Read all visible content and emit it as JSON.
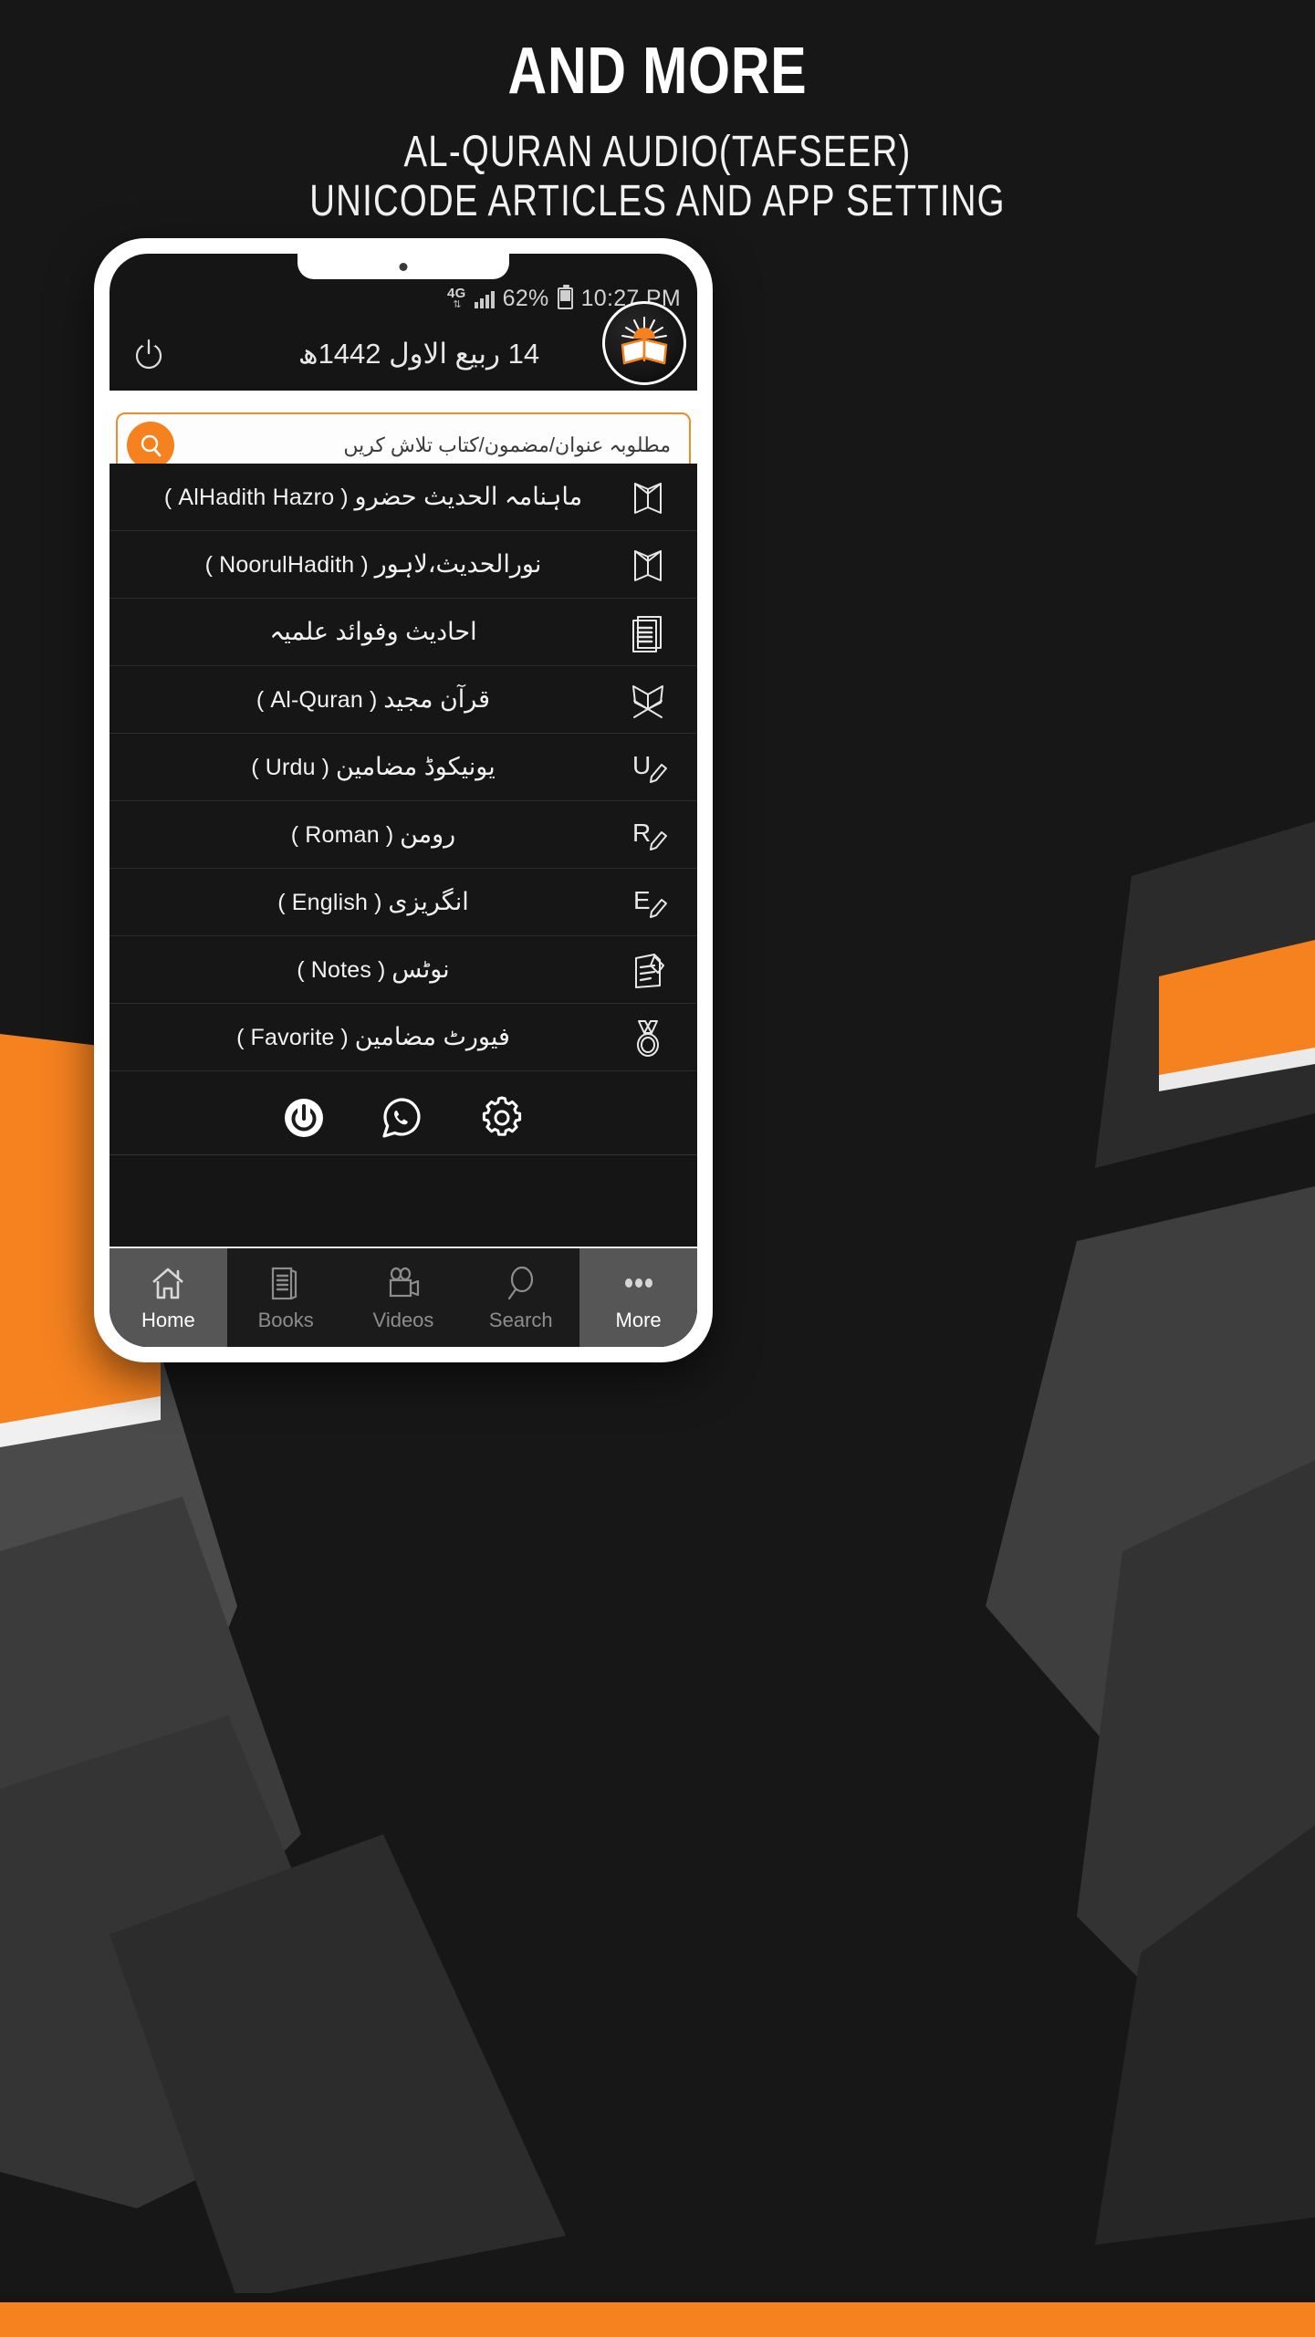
{
  "poster": {
    "headline": "AND MORE",
    "subline_1": "AL-QURAN AUDIO(TAFSEER)",
    "subline_2": "UNICODE ARTICLES AND APP SETTING",
    "accent_color": "#f5821f",
    "background_color": "#171717"
  },
  "phone": {
    "statusbar": {
      "network": "4G",
      "network_icon": "4g-data-icon",
      "signal_icon": "signal-bars-icon",
      "battery_percent": "62%",
      "battery_icon": "battery-icon",
      "time": "10:27 PM"
    },
    "appbar": {
      "power_icon": "power-icon",
      "hijri_date": "14 ربیع الاول 1442ھ",
      "logo_icon": "open-book-sunrise-logo"
    },
    "search": {
      "icon": "search-icon",
      "placeholder": "مطلوبہ عنوان/مضمون/کتاب تلاش کریں",
      "value": ""
    },
    "menu_items": [
      {
        "icon": "open-book-icon",
        "urdu": "ماہنامہ الحدیث حضرو",
        "latin": "( AlHadith Hazro )"
      },
      {
        "icon": "open-book-icon",
        "urdu": "نورالحدیث،لاہور",
        "latin": "( NoorulHadith )"
      },
      {
        "icon": "newspaper-icon",
        "urdu": "احادیث وفوائد علمیہ",
        "latin": ""
      },
      {
        "icon": "quran-stand-icon",
        "urdu": "قرآن مجید",
        "latin": "( Al-Quran )"
      },
      {
        "icon": "u-pencil-icon",
        "urdu": "یونیکوڈ مضامین",
        "latin": "( Urdu )"
      },
      {
        "icon": "r-pencil-icon",
        "urdu": "رومن",
        "latin": "( Roman )"
      },
      {
        "icon": "e-pencil-icon",
        "urdu": "انگریزی",
        "latin": "( English )"
      },
      {
        "icon": "notepad-pencil-icon",
        "urdu": "نوٹس",
        "latin": "( Notes )"
      },
      {
        "icon": "medal-icon",
        "urdu": "فیورٹ مضامین",
        "latin": "( Favorite )"
      }
    ],
    "action_icons": [
      {
        "icon": "power-icon",
        "name": "exit-app-button"
      },
      {
        "icon": "whatsapp-icon",
        "name": "whatsapp-button"
      },
      {
        "icon": "gear-icon",
        "name": "settings-button"
      }
    ],
    "bottom_nav": [
      {
        "label": "Home",
        "icon": "home-icon",
        "active": true
      },
      {
        "label": "Books",
        "icon": "books-icon",
        "active": false
      },
      {
        "label": "Videos",
        "icon": "video-icon",
        "active": false
      },
      {
        "label": "Search",
        "icon": "search-icon",
        "active": false
      },
      {
        "label": "More",
        "icon": "more-dots-icon",
        "active": true
      }
    ]
  }
}
